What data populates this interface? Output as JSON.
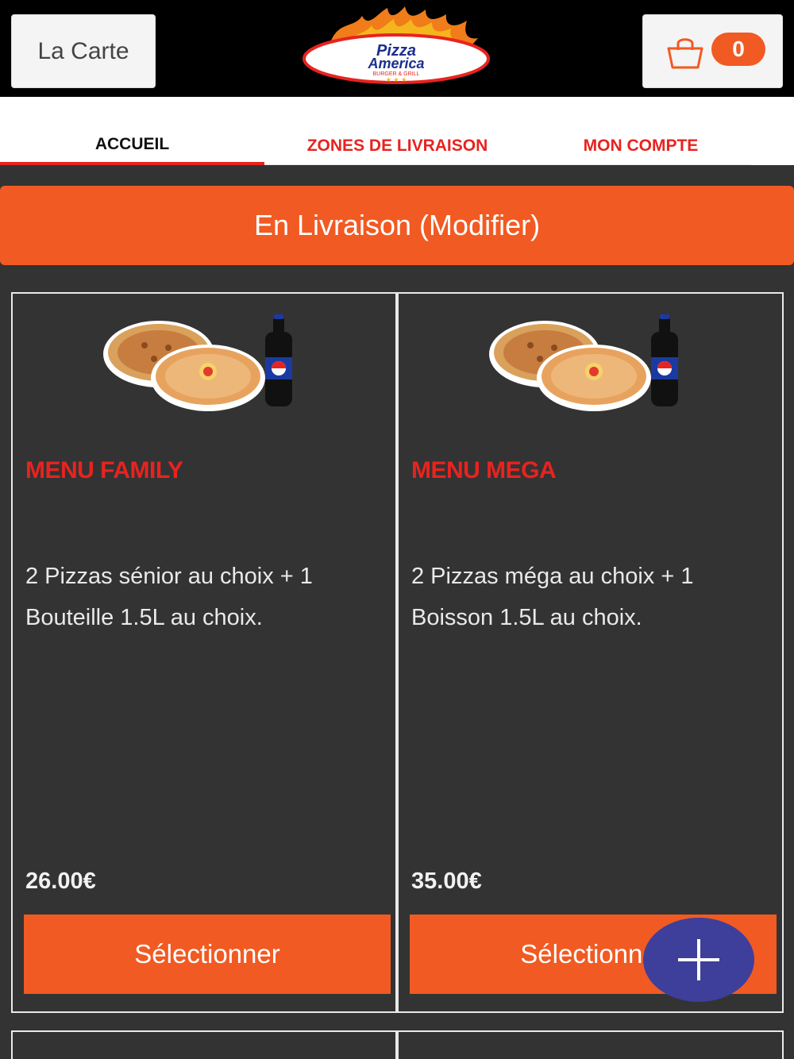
{
  "header": {
    "menu_button": "La Carte",
    "logo_line1": "Pizza",
    "logo_line2": "America",
    "logo_sub": "BURGER & GRILL",
    "cart_count": "0"
  },
  "nav": {
    "tabs": [
      {
        "label": "ACCUEIL",
        "active": true
      },
      {
        "label": "ZONES DE LIVRAISON",
        "active": false
      },
      {
        "label": "MON COMPTE",
        "active": false
      }
    ]
  },
  "delivery": {
    "label": "En Livraison (Modifier)"
  },
  "products": [
    {
      "title": "MENU FAMILY",
      "description": "2 Pizzas sénior au choix  + 1 Bouteille 1.5L au choix.",
      "price": "26.00€",
      "select_label": "Sélectionner"
    },
    {
      "title": "MENU MEGA",
      "description": "2 Pizzas méga au choix  + 1 Boisson 1.5L au choix.",
      "price": "35.00€",
      "select_label": "Sélectionner"
    }
  ],
  "colors": {
    "accent": "#f15a22",
    "red": "#e8231f",
    "background": "#333333",
    "fab": "#3d3f9b"
  },
  "icons": {
    "cart": "shopping-bag-icon",
    "fab": "plus-icon"
  }
}
